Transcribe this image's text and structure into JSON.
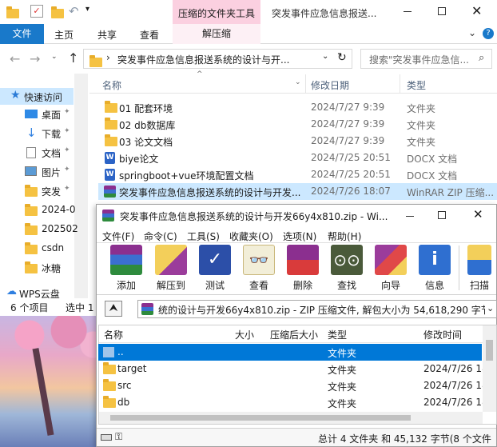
{
  "explorer": {
    "title_context_tab": "压缩的文件夹工具",
    "window_title": "突发事件应急信息报送...",
    "tabs": [
      "文件",
      "主页",
      "共享",
      "查看"
    ],
    "context_tab_label": "解压缩",
    "address": "突发事件应急信息报送系统的设计与开...",
    "search_placeholder": "搜索\"突发事件应急信...",
    "columns": {
      "name": "名称",
      "date": "修改日期",
      "type": "类型"
    },
    "nav": [
      "快速访问",
      "桌面",
      "下载",
      "文档",
      "图片",
      "突发",
      "2024-0",
      "202502",
      "csdn",
      "冰糖",
      "WPS云盘"
    ],
    "files": [
      {
        "icon": "folder",
        "name": "01 配套环境",
        "date": "2024/7/27 9:39",
        "type": "文件夹"
      },
      {
        "icon": "folder",
        "name": "02 db数据库",
        "date": "2024/7/27 9:39",
        "type": "文件夹"
      },
      {
        "icon": "folder",
        "name": "03 论文文档",
        "date": "2024/7/27 9:39",
        "type": "文件夹"
      },
      {
        "icon": "docx",
        "name": "biye论文",
        "date": "2024/7/25 20:51",
        "type": "DOCX 文档"
      },
      {
        "icon": "docx",
        "name": "springboot+vue环境配置文档",
        "date": "2024/7/25 20:51",
        "type": "DOCX 文档"
      },
      {
        "icon": "zip",
        "name": "突发事件应急信息报送系统的设计与开发...",
        "date": "2024/7/26 18:07",
        "type": "WinRAR ZIP 压缩..."
      }
    ],
    "status_count": "6 个项目",
    "status_selected": "选中 1"
  },
  "winrar": {
    "title": "突发事件应急信息报送系统的设计与开发66y4x810.zip - Wi...",
    "menu": [
      "文件(F)",
      "命令(C)",
      "工具(S)",
      "收藏夹(O)",
      "选项(N)",
      "帮助(H)"
    ],
    "toolbar": [
      "添加",
      "解压到",
      "测试",
      "查看",
      "删除",
      "查找",
      "向导",
      "信息",
      "扫描"
    ],
    "path": "统的设计与开发66y4x810.zip - ZIP 压缩文件, 解包大小为 54,618,290 字节",
    "columns": {
      "name": "名称",
      "size": "大小",
      "packed": "压缩后大小",
      "type": "类型",
      "modified": "修改时间"
    },
    "rows": [
      {
        "name": "..",
        "type": "文件夹",
        "modified": ""
      },
      {
        "name": "target",
        "type": "文件夹",
        "modified": "2024/7/26 18"
      },
      {
        "name": "src",
        "type": "文件夹",
        "modified": "2024/7/26 18"
      },
      {
        "name": "db",
        "type": "文件夹",
        "modified": "2024/7/26 18"
      }
    ],
    "status": "总计 4 文件夹 和 45,132 字节(8 个文件"
  },
  "colors": {
    "accent": "#1979ca",
    "context": "#fbd0e0",
    "selection": "#cce8ff",
    "winrar_sel": "#0078d7"
  }
}
